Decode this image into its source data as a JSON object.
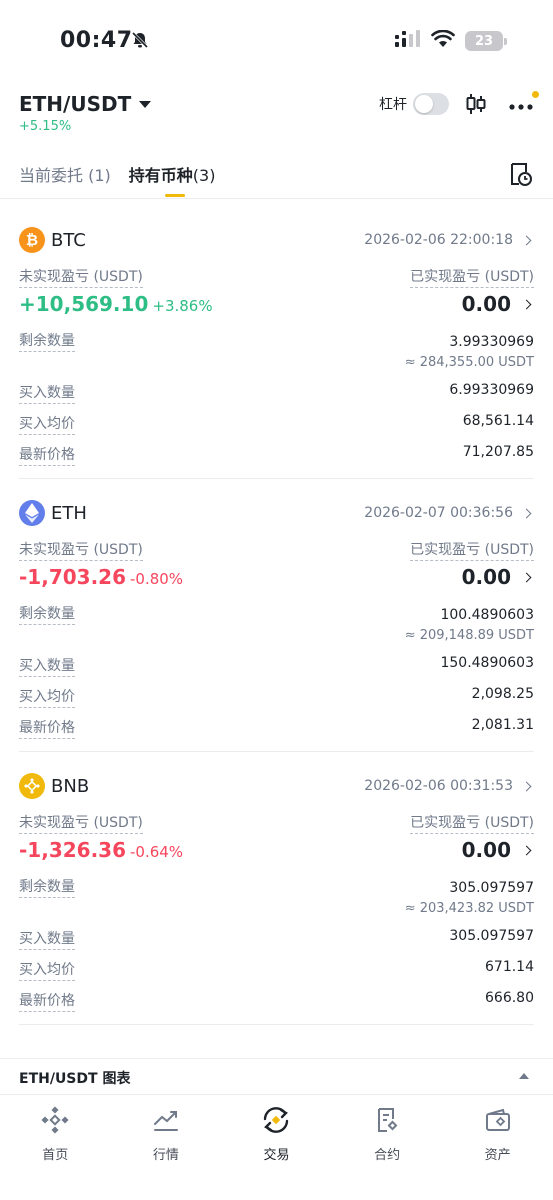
{
  "status_bar": {
    "time": "00:47",
    "battery": "23"
  },
  "header": {
    "pair": "ETH/USDT",
    "change": "+5.15%",
    "leverage_label": "杠杆"
  },
  "tabs": [
    {
      "label": "当前委托",
      "count": "(1)"
    },
    {
      "label": "持有币种",
      "count": "(3)"
    }
  ],
  "labels": {
    "unrealized": "未实现盈亏 (USDT)",
    "realized": "已实现盈亏 (USDT)",
    "remaining": "剩余数量",
    "bought": "买入数量",
    "avg_price": "买入均价",
    "last_price": "最新价格"
  },
  "assets": [
    {
      "symbol": "BTC",
      "icon": "bitcoin-icon",
      "color": "#f7931a",
      "time": "2026-02-06 22:00:18",
      "unrealized_pnl": "+10,569.10",
      "unrealized_pct": "+3.86%",
      "realized_pnl": "0.00",
      "remaining": "3.99330969",
      "remaining_value": "≈ 284,355.00 USDT",
      "bought": "6.99330969",
      "avg_price": "68,561.14",
      "last_price": "71,207.85"
    },
    {
      "symbol": "ETH",
      "icon": "ethereum-icon",
      "color": "#627eea",
      "time": "2026-02-07 00:36:56",
      "unrealized_pnl": "-1,703.26",
      "unrealized_pct": "-0.80%",
      "realized_pnl": "0.00",
      "remaining": "100.4890603",
      "remaining_value": "≈ 209,148.89 USDT",
      "bought": "150.4890603",
      "avg_price": "2,098.25",
      "last_price": "2,081.31"
    },
    {
      "symbol": "BNB",
      "icon": "bnb-icon",
      "color": "#f0b90b",
      "time": "2026-02-06 00:31:53",
      "unrealized_pnl": "-1,326.36",
      "unrealized_pct": "-0.64%",
      "realized_pnl": "0.00",
      "remaining": "305.097597",
      "remaining_value": "≈ 203,423.82 USDT",
      "bought": "305.097597",
      "avg_price": "671.14",
      "last_price": "666.80"
    }
  ],
  "chart_bar": {
    "label": "ETH/USDT 图表"
  },
  "bottom_nav": [
    {
      "label": "首页",
      "icon": "home-icon"
    },
    {
      "label": "行情",
      "icon": "markets-icon"
    },
    {
      "label": "交易",
      "icon": "trade-icon"
    },
    {
      "label": "合约",
      "icon": "futures-icon"
    },
    {
      "label": "资产",
      "icon": "wallet-icon"
    }
  ],
  "colors": {
    "up": "#2ebd85",
    "down": "#f6465d",
    "accent": "#f0b90b"
  }
}
